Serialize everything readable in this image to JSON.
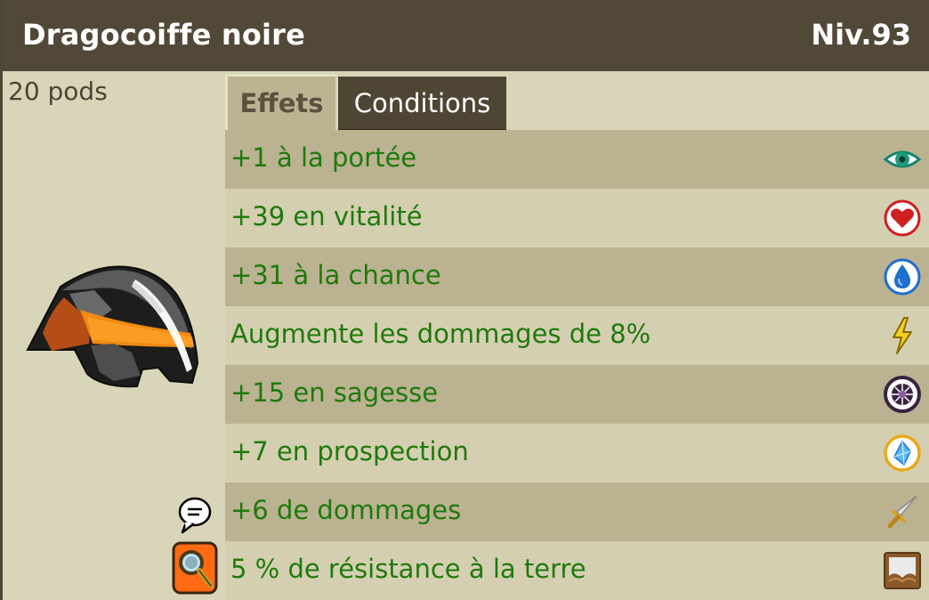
{
  "item": {
    "name": "Dragocoiffe noire",
    "level": "Niv.93",
    "weight": "20 pods"
  },
  "tabs": [
    {
      "label": "Effets",
      "active": true
    },
    {
      "label": "Conditions",
      "active": false
    }
  ],
  "effects": [
    {
      "text": "+1 à la portée",
      "icon": "range-eye-icon",
      "color": "#1e9a7a"
    },
    {
      "text": "+39 en vitalité",
      "icon": "vitality-heart-icon",
      "color": "#d01f1f"
    },
    {
      "text": "+31 à la chance",
      "icon": "chance-water-drop-icon",
      "color": "#1e6fd0"
    },
    {
      "text": "Augmente les dommages de 8%",
      "icon": "damage-lightning-icon",
      "color": "#e8c21a"
    },
    {
      "text": "+15 en sagesse",
      "icon": "wisdom-icon",
      "color": "#3a2340"
    },
    {
      "text": "+7 en prospection",
      "icon": "prospecting-crystal-icon",
      "color": "#e8a81a"
    },
    {
      "text": "+6 de dommages",
      "icon": "damage-sword-icon",
      "color": "#c9c9c9"
    },
    {
      "text": "5 % de résistance à la terre",
      "icon": "earth-resistance-icon",
      "color": "#8b5a2b"
    }
  ],
  "colors": {
    "header_bg": "#524838",
    "panel_bg": "#d9d5b8",
    "effect_text": "#1e7a0b",
    "row_dark": "#bbb292",
    "row_light": "#d5cfb2"
  }
}
